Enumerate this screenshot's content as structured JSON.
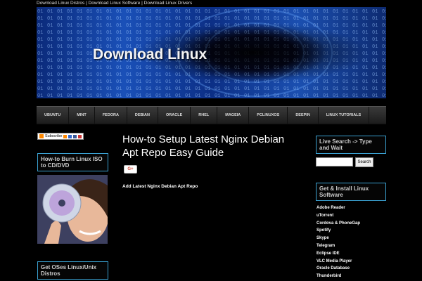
{
  "topbar": {
    "links": [
      "Download Linux Distros",
      "Download Linux Software",
      "Download Linux Drivers"
    ],
    "separator": " | "
  },
  "banner": {
    "title": "Download Linux"
  },
  "nav": {
    "items": [
      "UBUNTU",
      "MINT",
      "FEDORA",
      "DEBIAN",
      "ORACLE",
      "RHEL",
      "MAGEIA",
      "PCLINUXOS",
      "DEEPIN",
      "LINUX TUTORIALS"
    ]
  },
  "left_sidebar": {
    "subscribe_label": "Subscribe",
    "burn_heading": "How-to Burn Linux ISO to CD/DVD",
    "oses_heading": "Get OSes Linux/Unix Distros"
  },
  "post": {
    "title": "How-to Setup Latest Nginx Debian Apt Repo Easy Guide",
    "gplus_label": "G+",
    "subheading": "Add Latest Nginx Debian Apt Repo"
  },
  "right_sidebar": {
    "search_heading": "Live Search -> Type and Wait",
    "search_placeholder": "",
    "search_button": "Search",
    "software_heading": "Get & Install Linux Software",
    "software_items": [
      "Adobe Reader",
      "uTorrent",
      "Cordova & PhoneGap",
      "Spotify",
      "Skype",
      "Telegram",
      "Eclipse IDE",
      "VLC Media Player",
      "Oracle Database",
      "Thunderbird"
    ]
  },
  "colors": {
    "background": "#000000",
    "box_border": "#3aa0d0",
    "banner_blue": "#1a50b8"
  }
}
